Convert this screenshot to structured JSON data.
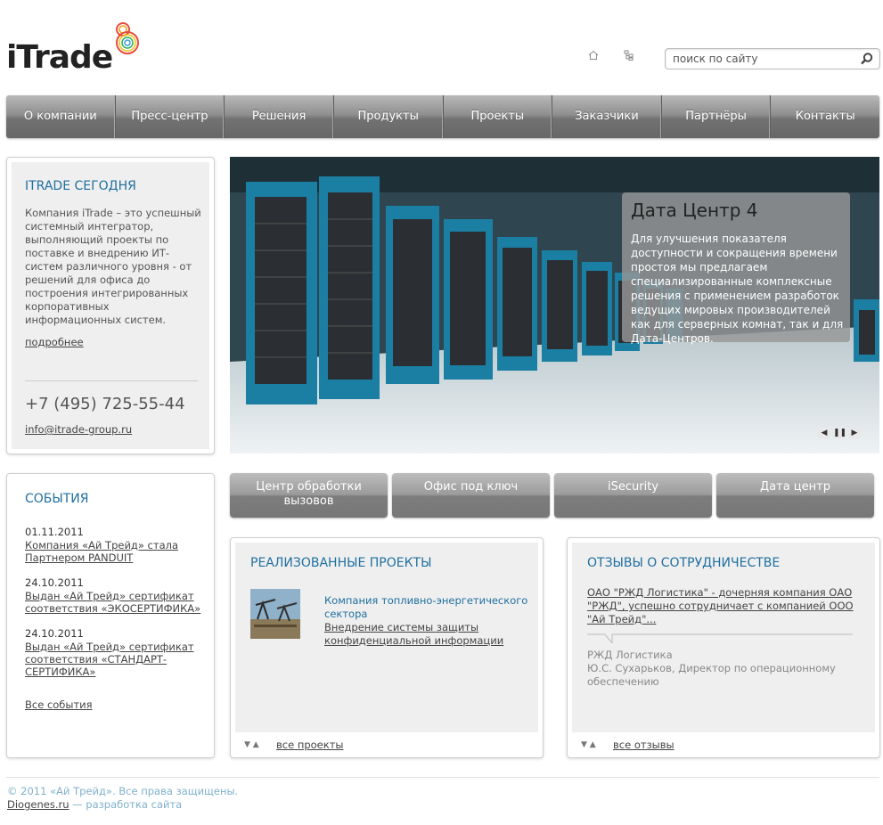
{
  "header": {
    "logo_text": "iTrade",
    "search_placeholder": "поиск по сайту",
    "home_icon": "home-icon",
    "sitemap_icon": "sitemap-icon"
  },
  "nav": [
    "О компании",
    "Пресс-центр",
    "Решения",
    "Продукты",
    "Проекты",
    "Заказчики",
    "Партнёры",
    "Контакты"
  ],
  "today": {
    "title": "ITRADE СЕГОДНЯ",
    "text": "Компания iTrade – это успешный системный интегратор, выполняющий проекты по поставке и внедрению ИТ-систем различного уровня - от решений для офиса до построения интегрированных корпоративных информационных систем.",
    "more": "подробнее",
    "phone": "+7 (495) 725-55-44",
    "email": "info@itrade-group.ru"
  },
  "slider": {
    "title": "Дата Центр 4",
    "text": "Для улучшения показателя доступности и сокращения времени простоя мы предлагаем специализированные комплексные решения с применением разработок ведущих мировых производителей как для серверных комнат, так и для Дата-Центров."
  },
  "events": {
    "title": "СОБЫТИЯ",
    "items": [
      {
        "date": "01.11.2011",
        "text": "Компания «Ай Трейд» стала Партнером PANDUIT"
      },
      {
        "date": "24.10.2011",
        "text": "Выдан «Ай Трейд» сертификат соответствия «ЭКОСЕРТИФИКА»"
      },
      {
        "date": "24.10.2011",
        "text": "Выдан «Ай Трейд» сертификат соответствия «СТАНДАРТ-СЕРТИФИКА»"
      }
    ],
    "all": "Все события"
  },
  "tabs": [
    "Центр обработки вызовов",
    "Офис под ключ",
    "iSecurity",
    "Дата центр"
  ],
  "projects": {
    "title": "РЕАЛИЗОВАННЫЕ ПРОЕКТЫ",
    "category": "Компания топливно-энергетического сектора",
    "link": "Внедрение системы защиты конфиденциальной информации",
    "all": "все проекты"
  },
  "reviews": {
    "title": "ОТЗЫВЫ О СОТРУДНИЧЕСТВЕ",
    "quote": "ОАО \"РЖД Логистика\" - дочерняя компания ОАО \"РЖД\", успешно сотрудничает с компанией ООО \"Ай Трейд\"...",
    "company": "РЖД Логистика",
    "person": "Ю.С. Сухарьков, Директор по операционному обеспечению",
    "all": "все отзывы"
  },
  "footer": {
    "copyright": "© 2011 «Ай Трейд». Все права защищены.",
    "dev_link": "Diogenes.ru",
    "dev_text": " — разработка сайта"
  },
  "colors": {
    "accent": "#1f6f9f",
    "nav": "#8f8f8f",
    "footer_text": "#7fb0cc"
  }
}
